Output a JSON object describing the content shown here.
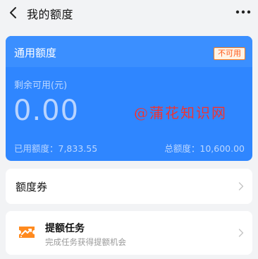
{
  "nav": {
    "title": "我的额度",
    "back_icon": "chevron-left-icon",
    "more_icon": "more-dots-icon"
  },
  "credit_card": {
    "title": "通用额度",
    "status_badge": "不可用",
    "available_label": "剩余可用(元)",
    "available_value": "0.00",
    "used_label": "已用额度：7,833.55",
    "total_label": "总额度：10,600.00",
    "watermark": "@蒲花知识网",
    "colors": {
      "card": "#2f86ff",
      "badge_text": "#ff5a1a"
    }
  },
  "coupon_row": {
    "label": "额度券"
  },
  "task_row": {
    "title": "提额任务",
    "subtitle": "完成任务获得提额机会",
    "icon": "ticket-icon"
  }
}
